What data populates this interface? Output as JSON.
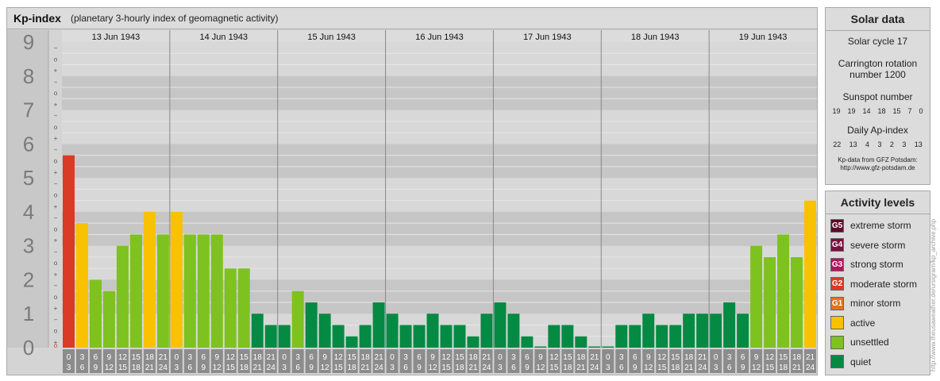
{
  "header": {
    "title": "Kp-index",
    "subtitle": "(planetary 3-hourly index of geomagnetic activity)"
  },
  "solar": {
    "heading": "Solar data",
    "cycle": "Solar cycle 17",
    "carrington": "Carrington rotation number 1200",
    "sunspot_label": "Sunspot number",
    "sunspot_values": [
      "19",
      "19",
      "14",
      "18",
      "15",
      "7",
      "0"
    ],
    "ap_label": "Daily Ap-index",
    "ap_values": [
      "22",
      "13",
      "4",
      "3",
      "2",
      "3",
      "13"
    ],
    "source_line1": "Kp-data from GFZ Potsdam:",
    "source_line2": "http://www.gfz-potsdam.de"
  },
  "activity": {
    "heading": "Activity levels",
    "levels": [
      {
        "code": "G5",
        "label": "extreme storm",
        "color": "#5c0a2a"
      },
      {
        "code": "G4",
        "label": "severe storm",
        "color": "#7a1040"
      },
      {
        "code": "G3",
        "label": "strong storm",
        "color": "#b0155e"
      },
      {
        "code": "G2",
        "label": "moderate storm",
        "color": "#d93b25"
      },
      {
        "code": "G1",
        "label": "minor storm",
        "color": "#e2731c"
      },
      {
        "code": "",
        "label": "active",
        "color": "#f8c200"
      },
      {
        "code": "",
        "label": "unsettled",
        "color": "#7ec21f"
      },
      {
        "code": "",
        "label": "quiet",
        "color": "#058a43"
      }
    ]
  },
  "watermark": "http://www.theusaweather.de/ursigram/kp_archive.php",
  "chart_data": {
    "type": "bar",
    "ylim": [
      0,
      9
    ],
    "yticks": [
      "0",
      "1",
      "2",
      "3",
      "4",
      "5",
      "6",
      "7",
      "8",
      "9"
    ],
    "sub_ticks": [
      "+",
      "o",
      "−"
    ],
    "days": [
      "13 Jun 1943",
      "14 Jun 1943",
      "15 Jun 1943",
      "16 Jun 1943",
      "17 Jun 1943",
      "18 Jun 1943",
      "19 Jun 1943"
    ],
    "interval_labels": [
      [
        "0",
        "3"
      ],
      [
        "3",
        "6"
      ],
      [
        "6",
        "9"
      ],
      [
        "9",
        "12"
      ],
      [
        "12",
        "15"
      ],
      [
        "15",
        "18"
      ],
      [
        "18",
        "21"
      ],
      [
        "21",
        "24"
      ]
    ],
    "values": [
      5.667,
      3.667,
      2.0,
      1.667,
      3.0,
      3.333,
      4.0,
      3.333,
      4.0,
      3.333,
      3.333,
      3.333,
      2.333,
      2.333,
      1.0,
      0.667,
      0.667,
      1.667,
      1.333,
      1.0,
      0.667,
      0.333,
      0.667,
      1.333,
      1.0,
      0.667,
      0.667,
      1.0,
      0.667,
      0.667,
      0.333,
      1.0,
      1.333,
      1.0,
      0.333,
      0.0,
      0.667,
      0.667,
      0.333,
      0.0,
      0.0,
      0.667,
      0.667,
      1.0,
      0.667,
      0.667,
      1.0,
      1.0,
      1.0,
      1.333,
      1.0,
      3.0,
      2.667,
      3.333,
      2.667,
      4.333
    ],
    "colors": {
      "quiet": "#058a43",
      "unsettled": "#7ec21f",
      "active": "#f8c200",
      "minor": "#e2731c",
      "moderate": "#d93b25"
    }
  }
}
